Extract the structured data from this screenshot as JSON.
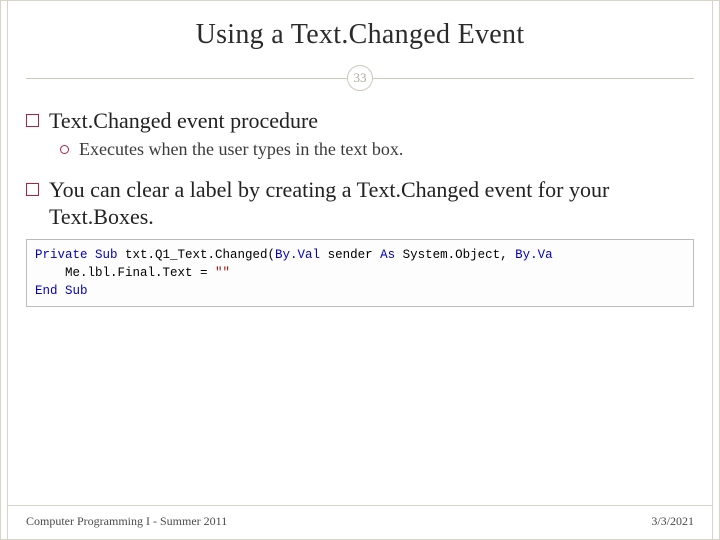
{
  "title": "Using a Text.Changed Event",
  "page_number": "33",
  "bullets": {
    "b1": "Text.Changed event procedure",
    "b1_sub1": "Executes when the user types in the text box.",
    "b2": "You can clear a label by creating a Text.Changed event for your Text.Boxes."
  },
  "code": {
    "kw_private_sub": "Private Sub",
    "fn": " txt.Q1_Text.Changed(",
    "kw_byval1": "By.Val",
    "arg1": " sender ",
    "kw_as1": "As",
    "type1": " System.Object, ",
    "kw_byval2": "By.Va",
    "line2_indent": "    ",
    "line2_body": "Me.lbl.Final.Text = ",
    "str_empty": "\"\"",
    "kw_end_sub": "End Sub"
  },
  "footer": {
    "left": "Computer Programming I - Summer 2011",
    "right": "3/3/2021"
  }
}
